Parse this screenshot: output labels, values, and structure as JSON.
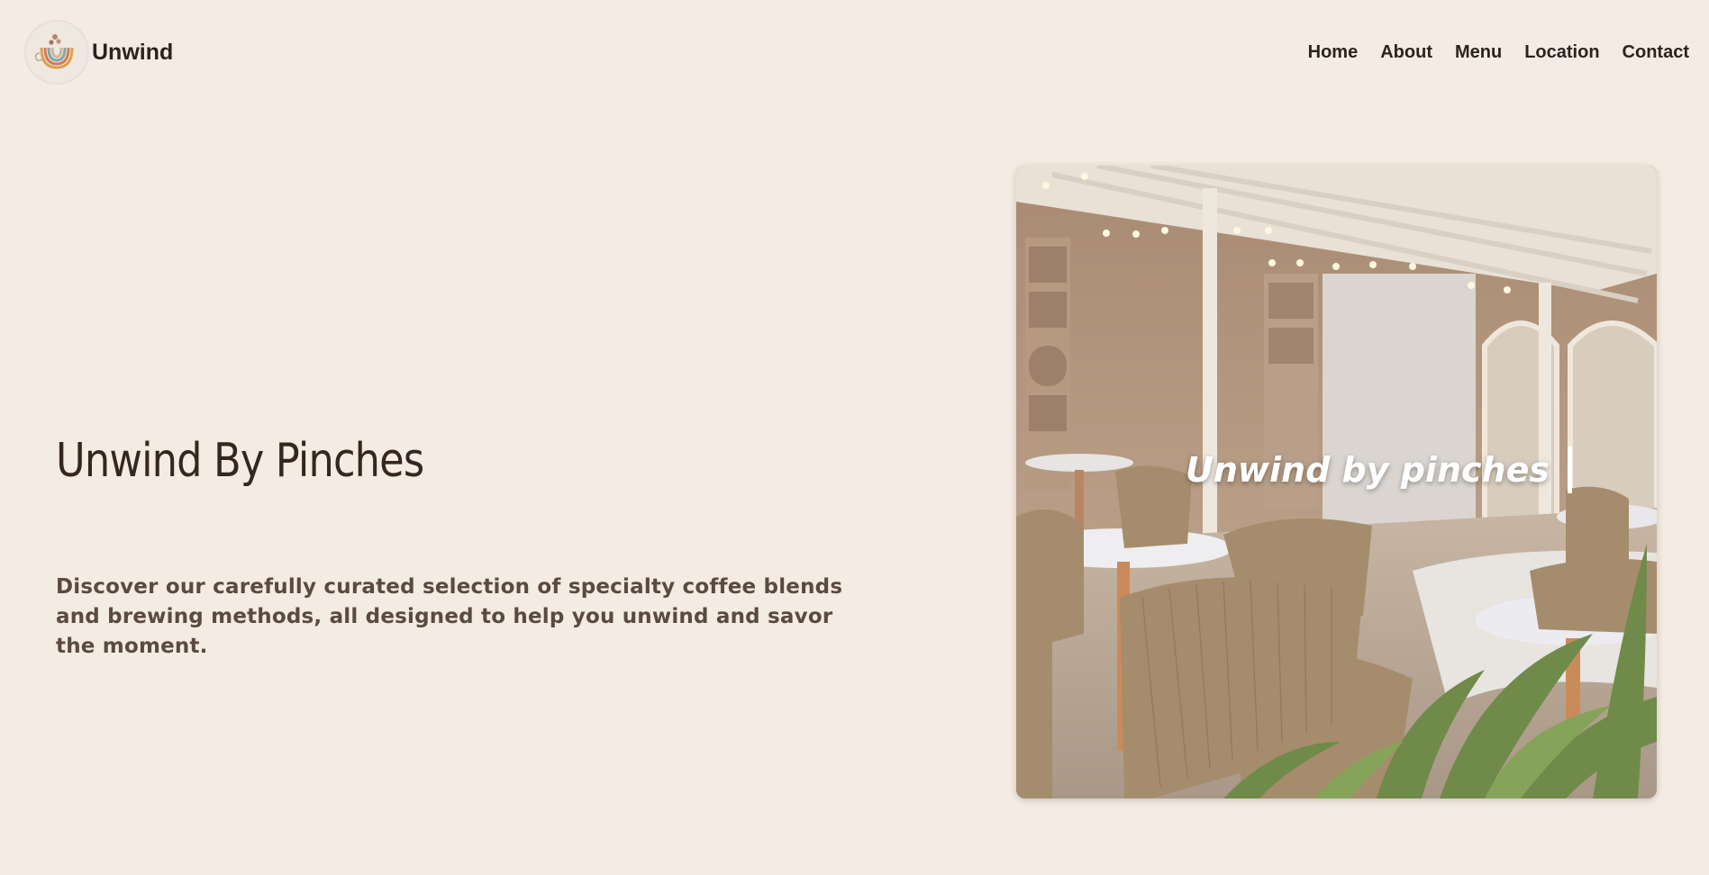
{
  "brand": {
    "name": "Unwind",
    "logo_icon": "coffee-cup-rainbow-icon"
  },
  "nav": {
    "links": [
      {
        "label": "Home"
      },
      {
        "label": "About"
      },
      {
        "label": "Menu"
      },
      {
        "label": "Location"
      },
      {
        "label": "Contact"
      }
    ]
  },
  "hero": {
    "title": "Unwind By Pinches",
    "description": "Discover our carefully curated selection of specialty coffee blends and brewing methods, all designed to help you unwind and savor the moment.",
    "image_overlay_text": "Unwind by pinches"
  },
  "colors": {
    "background": "#f4ece2",
    "text_dark": "#2e221c",
    "text_muted": "#5a4a42"
  }
}
